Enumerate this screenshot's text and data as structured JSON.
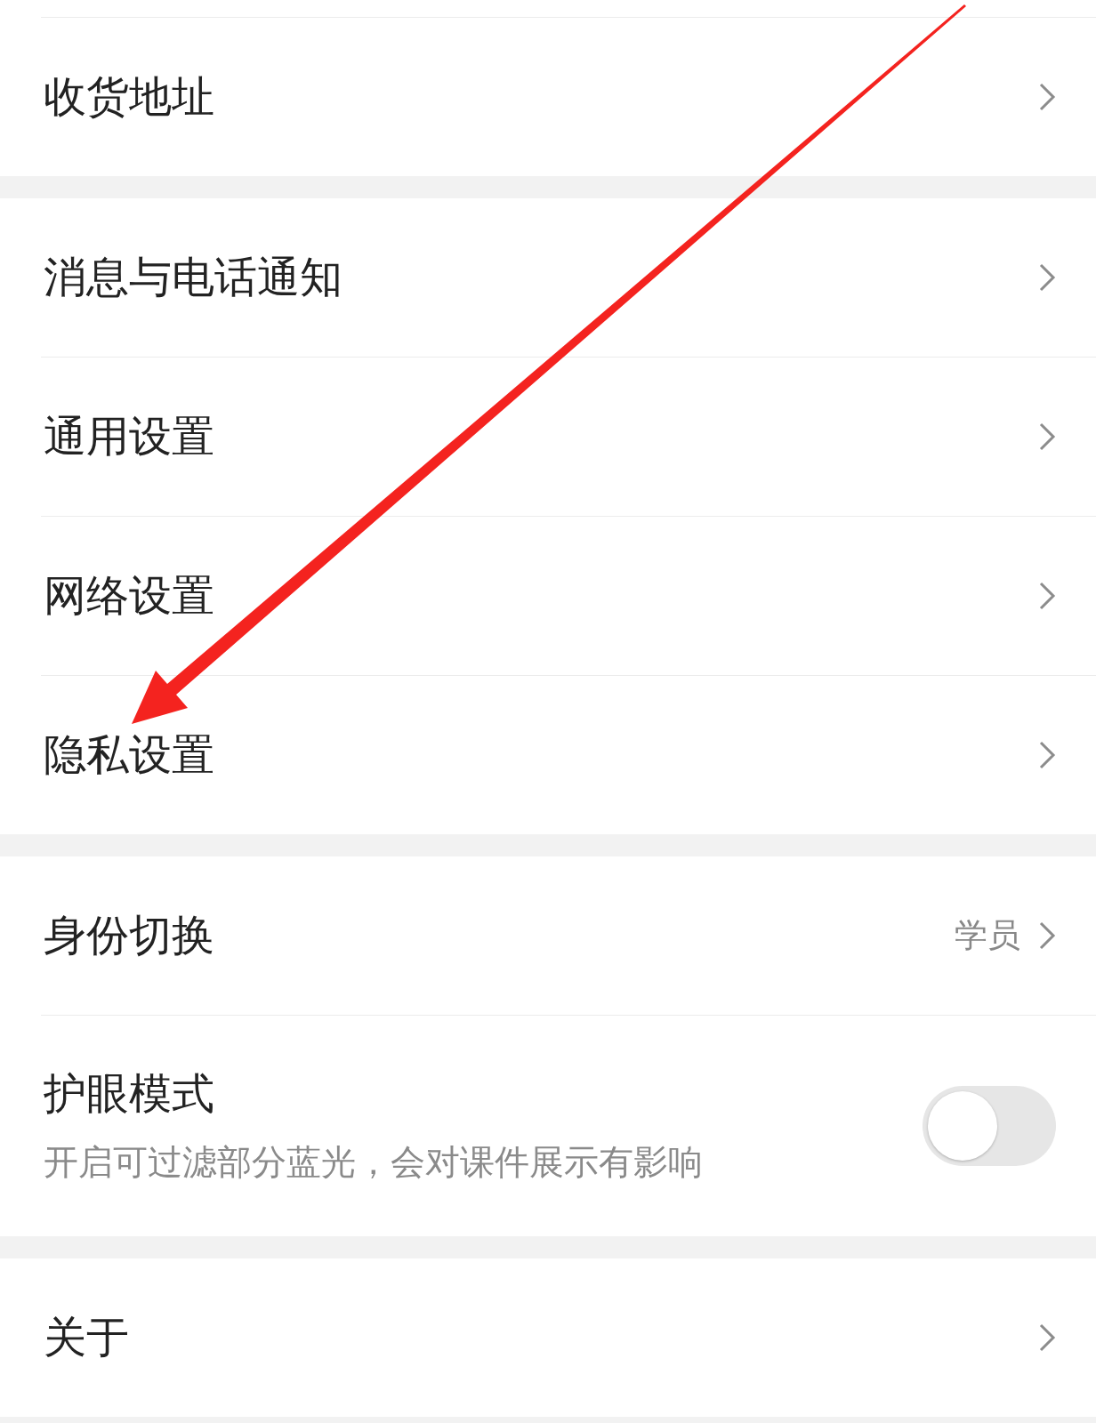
{
  "sections": [
    {
      "items": [
        {
          "kind": "link",
          "label": "收货地址"
        }
      ]
    },
    {
      "items": [
        {
          "kind": "link",
          "label": "消息与电话通知"
        },
        {
          "kind": "link",
          "label": "通用设置"
        },
        {
          "kind": "link",
          "label": "网络设置"
        },
        {
          "kind": "link",
          "label": "隐私设置"
        }
      ]
    },
    {
      "items": [
        {
          "kind": "link",
          "label": "身份切换",
          "value": "学员"
        },
        {
          "kind": "toggle",
          "label": "护眼模式",
          "description": "开启可过滤部分蓝光，会对课件展示有影响",
          "on": false
        }
      ]
    },
    {
      "items": [
        {
          "kind": "link",
          "label": "关于"
        }
      ]
    }
  ]
}
